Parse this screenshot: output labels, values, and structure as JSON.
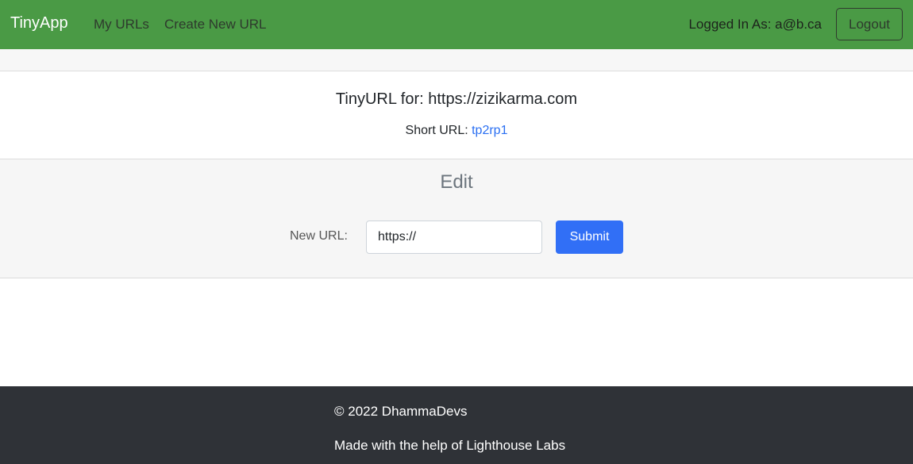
{
  "nav": {
    "brand": "TinyApp",
    "links": [
      "My URLs",
      "Create New URL"
    ],
    "logged_in": "Logged In As: a@b.ca",
    "logout": "Logout"
  },
  "url": {
    "title": "TinyURL for: https://zizikarma.com",
    "short_label": "Short URL: ",
    "short_value": "tp2rp1"
  },
  "edit": {
    "heading": "Edit",
    "label": "New URL:",
    "value": "https://",
    "submit": "Submit"
  },
  "footer": {
    "copyright": "© 2022 DhammaDevs",
    "credit": "Made with the help of Lighthouse Labs"
  },
  "colors": {
    "navbar": "#4a9a45",
    "primary": "#316ff6",
    "footer": "#2f3237"
  }
}
